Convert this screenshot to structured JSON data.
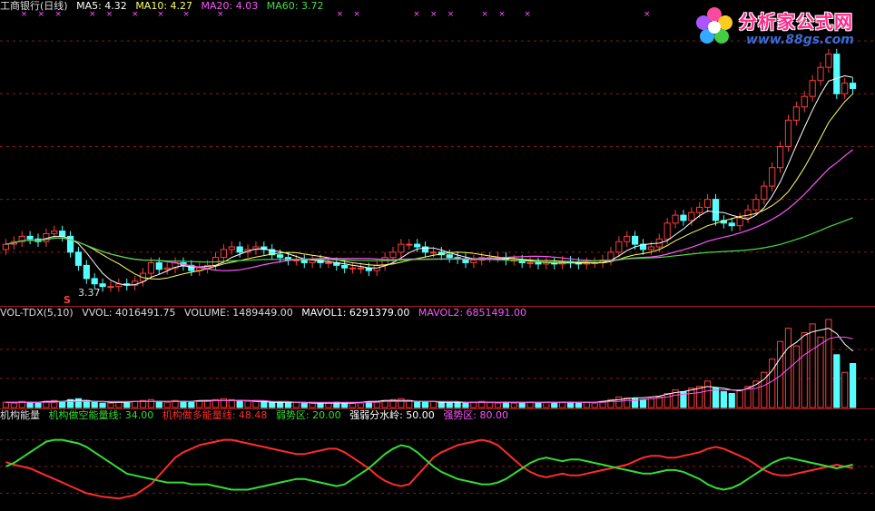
{
  "price_legend": {
    "name": "工商银行(日线)",
    "ma5": "MA5: 4.32",
    "ma10": "MA10: 4.27",
    "ma20": "MA20: 4.03",
    "ma60": "MA60: 3.72",
    "low_marker": "3.37",
    "s_marker": "S"
  },
  "vol_legend": {
    "name": "VOL-TDX(5,10)",
    "vvol": "VVOL: 4016491.75",
    "volume": "VOLUME: 1489449.00",
    "mavol1": "MAVOL1: 6291379.00",
    "mavol2": "MAVOL2: 6851491.00"
  },
  "ind_legend": {
    "name": "机构能量",
    "short": "机构做空能量线: 34.00",
    "long": "机构做多能量线: 48.48",
    "weak": "弱势区: 20.00",
    "mid": "强弱分水岭: 50.00",
    "strong": "强势区: 80.00"
  },
  "watermark": {
    "title": "分析家公式网",
    "url": "www.88gs.com"
  },
  "colors": {
    "up": "#ff3c3c",
    "down": "#54ffff",
    "ma5": "#ffffff",
    "ma10": "#ffff66",
    "ma20": "#ff55ff",
    "ma60": "#44dd44",
    "grid": "#8b1a1a",
    "red_line": "#ff2b2b",
    "green_line": "#33dd33"
  },
  "chart_data": {
    "type": "candlestick",
    "price_ylim": [
      3.2,
      5.4
    ],
    "price_grid": [
      3.6,
      4.0,
      4.4,
      4.8,
      5.2
    ],
    "price_open": [
      3.62,
      3.66,
      3.68,
      3.72,
      3.7,
      3.68,
      3.74,
      3.76,
      3.72,
      3.6,
      3.5,
      3.4,
      3.36,
      3.34,
      3.34,
      3.36,
      3.35,
      3.38,
      3.44,
      3.52,
      3.47,
      3.48,
      3.52,
      3.5,
      3.46,
      3.48,
      3.5,
      3.56,
      3.62,
      3.64,
      3.6,
      3.62,
      3.64,
      3.62,
      3.58,
      3.56,
      3.54,
      3.54,
      3.52,
      3.54,
      3.52,
      3.52,
      3.5,
      3.48,
      3.48,
      3.48,
      3.46,
      3.5,
      3.56,
      3.6,
      3.66,
      3.66,
      3.64,
      3.6,
      3.6,
      3.58,
      3.56,
      3.55,
      3.52,
      3.54,
      3.56,
      3.56,
      3.56,
      3.54,
      3.54,
      3.52,
      3.52,
      3.51,
      3.52,
      3.51,
      3.53,
      3.52,
      3.51,
      3.52,
      3.52,
      3.54,
      3.6,
      3.68,
      3.72,
      3.66,
      3.62,
      3.64,
      3.7,
      3.82,
      3.88,
      3.84,
      3.9,
      3.94,
      4.0,
      3.84,
      3.82,
      3.8,
      3.86,
      3.92,
      4.0,
      4.1,
      4.24,
      4.4,
      4.6,
      4.7,
      4.78,
      4.9,
      5.0,
      5.1,
      4.8,
      4.88
    ],
    "price_close": [
      3.66,
      3.68,
      3.72,
      3.7,
      3.68,
      3.74,
      3.76,
      3.72,
      3.6,
      3.5,
      3.4,
      3.36,
      3.34,
      3.34,
      3.36,
      3.35,
      3.38,
      3.44,
      3.52,
      3.47,
      3.48,
      3.52,
      3.5,
      3.46,
      3.48,
      3.5,
      3.56,
      3.62,
      3.64,
      3.6,
      3.62,
      3.64,
      3.62,
      3.58,
      3.56,
      3.54,
      3.54,
      3.52,
      3.54,
      3.52,
      3.52,
      3.5,
      3.48,
      3.48,
      3.48,
      3.46,
      3.5,
      3.56,
      3.6,
      3.66,
      3.66,
      3.64,
      3.6,
      3.6,
      3.58,
      3.56,
      3.55,
      3.52,
      3.54,
      3.56,
      3.56,
      3.56,
      3.54,
      3.54,
      3.52,
      3.52,
      3.51,
      3.52,
      3.51,
      3.53,
      3.52,
      3.51,
      3.52,
      3.52,
      3.54,
      3.6,
      3.68,
      3.72,
      3.66,
      3.62,
      3.64,
      3.7,
      3.82,
      3.88,
      3.84,
      3.9,
      3.94,
      4.0,
      3.84,
      3.82,
      3.8,
      3.86,
      3.92,
      4.0,
      4.1,
      4.24,
      4.4,
      4.6,
      4.7,
      4.78,
      4.9,
      5.0,
      5.1,
      4.8,
      4.88,
      4.84
    ],
    "volume_ylim": [
      0,
      100
    ],
    "volume": [
      6,
      5,
      7,
      6,
      5,
      7,
      8,
      6,
      9,
      10,
      8,
      6,
      5,
      5,
      6,
      5,
      7,
      8,
      9,
      7,
      6,
      8,
      7,
      6,
      7,
      8,
      9,
      10,
      9,
      8,
      7,
      8,
      7,
      6,
      6,
      5,
      6,
      5,
      6,
      5,
      5,
      6,
      5,
      5,
      5,
      6,
      7,
      8,
      9,
      10,
      8,
      7,
      6,
      7,
      6,
      5,
      6,
      5,
      6,
      7,
      6,
      5,
      6,
      5,
      5,
      6,
      5,
      6,
      5,
      6,
      6,
      5,
      6,
      5,
      7,
      9,
      12,
      11,
      10,
      9,
      10,
      12,
      16,
      20,
      18,
      22,
      24,
      30,
      22,
      18,
      16,
      20,
      24,
      30,
      40,
      55,
      75,
      90,
      70,
      85,
      95,
      80,
      100,
      60,
      40,
      50
    ],
    "mavol1_fraction": [
      0.06,
      0.06,
      0.06,
      0.06,
      0.06,
      0.07,
      0.07,
      0.07,
      0.08,
      0.08,
      0.08,
      0.07,
      0.07,
      0.06,
      0.06,
      0.06,
      0.07,
      0.07,
      0.07,
      0.07,
      0.07,
      0.07,
      0.07,
      0.07,
      0.08,
      0.08,
      0.08,
      0.08,
      0.08,
      0.08,
      0.08,
      0.07,
      0.07,
      0.06,
      0.06,
      0.06,
      0.06,
      0.06,
      0.05,
      0.05,
      0.05,
      0.05,
      0.05,
      0.05,
      0.06,
      0.07,
      0.07,
      0.08,
      0.08,
      0.08,
      0.08,
      0.07,
      0.07,
      0.07,
      0.06,
      0.06,
      0.06,
      0.06,
      0.06,
      0.06,
      0.06,
      0.06,
      0.06,
      0.06,
      0.06,
      0.06,
      0.06,
      0.06,
      0.06,
      0.06,
      0.06,
      0.06,
      0.06,
      0.06,
      0.07,
      0.08,
      0.09,
      0.1,
      0.11,
      0.11,
      0.12,
      0.13,
      0.15,
      0.17,
      0.18,
      0.2,
      0.22,
      0.24,
      0.23,
      0.22,
      0.2,
      0.19,
      0.22,
      0.26,
      0.32,
      0.42,
      0.56,
      0.68,
      0.74,
      0.82,
      0.86,
      0.88,
      0.9,
      0.84,
      0.72,
      0.64
    ],
    "mavol2_fraction": [
      0.06,
      0.06,
      0.06,
      0.06,
      0.06,
      0.06,
      0.06,
      0.07,
      0.07,
      0.07,
      0.07,
      0.07,
      0.07,
      0.07,
      0.07,
      0.07,
      0.07,
      0.07,
      0.07,
      0.07,
      0.07,
      0.07,
      0.07,
      0.07,
      0.07,
      0.07,
      0.08,
      0.08,
      0.08,
      0.08,
      0.08,
      0.08,
      0.08,
      0.07,
      0.07,
      0.07,
      0.06,
      0.06,
      0.06,
      0.06,
      0.06,
      0.06,
      0.06,
      0.06,
      0.06,
      0.06,
      0.06,
      0.07,
      0.07,
      0.07,
      0.07,
      0.07,
      0.07,
      0.07,
      0.07,
      0.07,
      0.07,
      0.06,
      0.06,
      0.06,
      0.06,
      0.06,
      0.06,
      0.06,
      0.06,
      0.06,
      0.06,
      0.06,
      0.06,
      0.06,
      0.06,
      0.06,
      0.06,
      0.06,
      0.06,
      0.07,
      0.07,
      0.08,
      0.08,
      0.09,
      0.1,
      0.11,
      0.12,
      0.14,
      0.15,
      0.16,
      0.17,
      0.19,
      0.2,
      0.2,
      0.2,
      0.2,
      0.21,
      0.22,
      0.25,
      0.3,
      0.36,
      0.44,
      0.52,
      0.6,
      0.66,
      0.72,
      0.78,
      0.8,
      0.8,
      0.78
    ],
    "indicator_ylim": [
      0,
      100
    ],
    "indicator_red": [
      55,
      52,
      50,
      48,
      44,
      40,
      36,
      32,
      28,
      24,
      20,
      18,
      16,
      15,
      14,
      16,
      18,
      24,
      30,
      40,
      50,
      60,
      66,
      70,
      74,
      76,
      78,
      80,
      80,
      78,
      76,
      74,
      72,
      70,
      68,
      66,
      64,
      64,
      66,
      68,
      70,
      70,
      66,
      60,
      54,
      48,
      40,
      34,
      30,
      28,
      30,
      40,
      50,
      60,
      66,
      70,
      74,
      76,
      78,
      80,
      78,
      74,
      66,
      58,
      50,
      44,
      40,
      38,
      40,
      42,
      40,
      40,
      42,
      44,
      46,
      48,
      50,
      52,
      56,
      60,
      62,
      62,
      60,
      60,
      62,
      64,
      66,
      70,
      72,
      70,
      66,
      62,
      58,
      52,
      46,
      42,
      40,
      40,
      42,
      44,
      46,
      48,
      50,
      52,
      50,
      48
    ],
    "indicator_green": [
      50,
      54,
      60,
      66,
      72,
      78,
      80,
      80,
      78,
      76,
      72,
      66,
      60,
      54,
      48,
      42,
      40,
      38,
      36,
      34,
      32,
      32,
      32,
      30,
      30,
      30,
      28,
      26,
      24,
      24,
      24,
      26,
      28,
      30,
      32,
      34,
      36,
      36,
      34,
      32,
      30,
      28,
      30,
      36,
      42,
      48,
      56,
      64,
      70,
      74,
      72,
      66,
      58,
      50,
      44,
      40,
      36,
      34,
      32,
      30,
      30,
      32,
      36,
      42,
      48,
      54,
      58,
      60,
      58,
      56,
      58,
      58,
      56,
      54,
      52,
      50,
      48,
      46,
      44,
      42,
      42,
      44,
      46,
      46,
      44,
      40,
      36,
      30,
      26,
      24,
      26,
      30,
      36,
      42,
      48,
      54,
      58,
      60,
      58,
      56,
      54,
      52,
      50,
      48,
      50,
      52
    ],
    "indicator_levels": [
      20,
      50,
      80
    ],
    "star_marks_fraction": [
      0.02,
      0.04,
      0.06,
      0.1,
      0.12,
      0.15,
      0.18,
      0.21,
      0.25,
      0.39,
      0.41,
      0.48,
      0.5,
      0.52,
      0.56,
      0.58,
      0.61,
      0.75
    ]
  }
}
